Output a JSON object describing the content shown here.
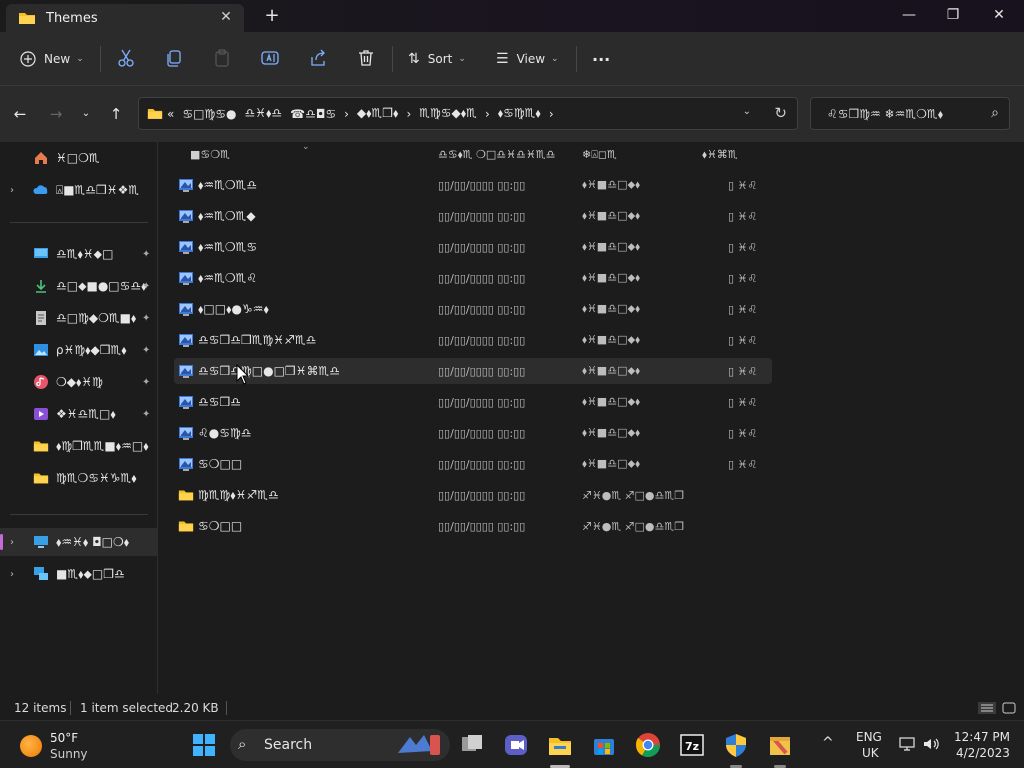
{
  "window": {
    "tab_title": "Themes",
    "close_tab": "✕",
    "new_tab": "+",
    "minimize": "—",
    "maximize": "❐",
    "close": "✕"
  },
  "toolbar": {
    "new_label": "New",
    "sort_label": "Sort",
    "view_label": "View",
    "more_label": "···"
  },
  "address": {
    "segments": [
      "«",
      "♋︎□︎♍︎♋︎●︎",
      "♎︎♓︎⬧︎♎︎",
      "☎︎♎︎◘︎♋︎",
      "›",
      "◆︎⬧︎♏︎❒︎⬧︎",
      "›",
      "♏︎♍︎♋︎◆︎⬧︎♏︎",
      "›",
      "⬧︎♋︎♍︎♏︎⬧︎",
      "›"
    ],
    "search_placeholder": "♌︎♋︎❒︎♍︎♒︎  ❄︎♒︎♏︎❍︎♏︎⬧︎",
    "breadcrumb_arrow": "›"
  },
  "sidebar": {
    "items": [
      {
        "label": "♓︎□︎❍︎♏︎",
        "icon": "home-icon",
        "expand": ""
      },
      {
        "label": "⍓︎■︎♏︎♎︎❒︎♓︎❖︎♏︎",
        "icon": "onedrive-icon",
        "expand": "›"
      },
      {
        "label": "♎︎♏︎⬧︎♓︎⬥︎□︎",
        "icon": "desktop-icon",
        "expand": ""
      },
      {
        "label": "♎︎□︎⬥︎■︎●︎□︎♋︎♎︎⬧︎",
        "icon": "download-icon",
        "expand": ""
      },
      {
        "label": "♎︎□︎♍︎◆︎❍︎♏︎■︎⬧︎",
        "icon": "document-icon",
        "expand": ""
      },
      {
        "label": "⍴︎♓︎♍︎⬧︎◆︎❒︎♏︎⬧︎",
        "icon": "pictures-icon",
        "expand": ""
      },
      {
        "label": "❍︎◆︎⬧︎♓︎♍︎",
        "icon": "music-icon",
        "expand": ""
      },
      {
        "label": "❖︎♓︎♎︎♏︎□︎⬧︎",
        "icon": "videos-icon",
        "expand": ""
      },
      {
        "label": "⬧︎♍︎❒︎♏︎♏︎■︎⬧︎♒︎□︎⬧︎",
        "icon": "folder-icon",
        "expand": ""
      },
      {
        "label": "♍︎♏︎❍︎♋︎♓︎♑︎♏︎⬧︎",
        "icon": "folder-icon",
        "expand": ""
      },
      {
        "label": "⬧︎♒︎♓︎⬧︎  ◘︎□︎❍︎⬧︎",
        "icon": "this-pc-icon",
        "expand": "›"
      },
      {
        "label": "■︎♏︎⬧︎⬥︎□︎❒︎♎︎",
        "icon": "network-icon",
        "expand": "›"
      }
    ],
    "pin_glyph": "📌"
  },
  "columns": {
    "name": "■︎♋︎❍︎♏︎",
    "date": "♎︎♋︎⬧︎♏︎  ❍︎□︎♎︎♓︎♎︎♓︎♏︎♎︎",
    "type": "❄︎⍓︎◻︎♏︎",
    "size": "⬧︎♓︎⌘︎♏︎"
  },
  "files": [
    {
      "name": "⬧︎♒︎♏︎❍︎♏︎♎︎",
      "date": "▯▯/▯▯/▯▯▯▯ ▯▯:▯▯",
      "type": "⬧︎♓︎■︎♎︎□︎⬥︎⬧︎",
      "size": "▯ ♓︎♌︎",
      "icon": "theme-file-icon"
    },
    {
      "name": "⬧︎♒︎♏︎❍︎♏︎◆︎",
      "date": "▯▯/▯▯/▯▯▯▯ ▯▯:▯▯",
      "type": "⬧︎♓︎■︎♎︎□︎⬥︎⬧︎",
      "size": "▯ ♓︎♌︎",
      "icon": "theme-file-icon"
    },
    {
      "name": "⬧︎♒︎♏︎❍︎♏︎♋︎",
      "date": "▯▯/▯▯/▯▯▯▯ ▯▯:▯▯",
      "type": "⬧︎♓︎■︎♎︎□︎⬥︎⬧︎",
      "size": "▯ ♓︎♌︎",
      "icon": "theme-file-icon"
    },
    {
      "name": "⬧︎♒︎♏︎❍︎♏︎♌︎",
      "date": "▯▯/▯▯/▯▯▯▯ ▯▯:▯▯",
      "type": "⬧︎♓︎■︎♎︎□︎⬥︎⬧︎",
      "size": "▯ ♓︎♌︎",
      "icon": "theme-file-icon"
    },
    {
      "name": "⬧︎□︎□︎⬧︎●︎♑︎♒︎⬧︎",
      "date": "▯▯/▯▯/▯▯▯▯ ▯▯:▯▯",
      "type": "⬧︎♓︎■︎♎︎□︎⬥︎⬧︎",
      "size": "▯ ♓︎♌︎",
      "icon": "theme-file-icon"
    },
    {
      "name": "♎︎♋︎❒︎♎︎❒︎♏︎♍︎♓︎♐︎♏︎♎︎",
      "date": "▯▯/▯▯/▯▯▯▯ ▯▯:▯▯",
      "type": "⬧︎♓︎■︎♎︎□︎⬥︎⬧︎",
      "size": "▯ ♓︎♌︎",
      "icon": "theme-file-icon"
    },
    {
      "name": "♎︎♋︎❒︎♎︎♍︎□︎●︎□︎❒︎♓︎⌘︎♏︎♎︎",
      "date": "▯▯/▯▯/▯▯▯▯ ▯▯:▯▯",
      "type": "⬧︎♓︎■︎♎︎□︎⬥︎⬧︎",
      "size": "▯ ♓︎♌︎",
      "icon": "theme-file-icon"
    },
    {
      "name": "♎︎♋︎❒︎♎︎",
      "date": "▯▯/▯▯/▯▯▯▯ ▯▯:▯▯",
      "type": "⬧︎♓︎■︎♎︎□︎⬥︎⬧︎",
      "size": "▯ ♓︎♌︎",
      "icon": "theme-file-icon"
    },
    {
      "name": "♌︎●︎♋︎♍︎♎︎",
      "date": "▯▯/▯▯/▯▯▯▯ ▯▯:▯▯",
      "type": "⬧︎♓︎■︎♎︎□︎⬥︎⬧︎",
      "size": "▯ ♓︎♌︎",
      "icon": "theme-file-icon"
    },
    {
      "name": "♋︎❍︎□︎□︎",
      "date": "▯▯/▯▯/▯▯▯▯ ▯▯:▯▯",
      "type": "⬧︎♓︎■︎♎︎□︎⬥︎⬧︎",
      "size": "▯ ♓︎♌︎",
      "icon": "theme-file-icon"
    },
    {
      "name": "♍︎♏︎♍︎⬧︎♓︎♐︎♏︎♎︎",
      "date": "▯▯/▯▯/▯▯▯▯ ▯▯:▯▯",
      "type": "♐︎♓︎●︎♏︎  ♐︎□︎●︎♎︎♏︎❒︎",
      "size": "",
      "icon": "folder-icon"
    },
    {
      "name": "♋︎❍︎□︎□︎",
      "date": "▯▯/▯▯/▯▯▯▯ ▯▯:▯▯",
      "type": "♐︎♓︎●︎♏︎  ♐︎□︎●︎♎︎♏︎❒︎",
      "size": "",
      "icon": "folder-icon"
    }
  ],
  "status": {
    "count": "12 items",
    "selected": "1 item selected",
    "size": "2.20 KB"
  },
  "taskbar": {
    "temp": "50°F",
    "condition": "Sunny",
    "search_label": "Search",
    "lang_top": "ENG",
    "lang_bottom": "UK",
    "time": "12:47 PM",
    "date": "4/2/2023",
    "chevron": "^"
  },
  "colors": {
    "accent": "#c46bd6",
    "folder": "#f4c02a",
    "theme_icon": "#3b7ad6"
  }
}
